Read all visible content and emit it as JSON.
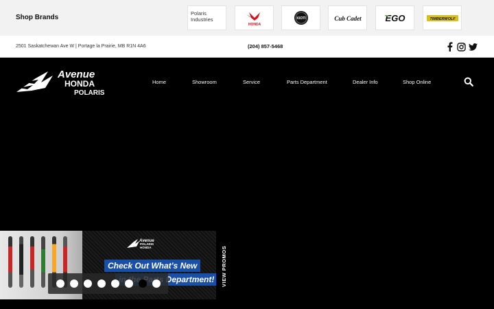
{
  "brands": {
    "title": "Shop Brands",
    "items": [
      {
        "name": "polaris",
        "label": "Polaris Industries"
      },
      {
        "name": "honda",
        "label": "HONDA"
      },
      {
        "name": "kioti",
        "label": "KIOTI"
      },
      {
        "name": "cubcadet",
        "label": "Cub Cadet"
      },
      {
        "name": "ego",
        "label": "EGO"
      },
      {
        "name": "timberwolf",
        "label": "TIMBERWOLF"
      }
    ]
  },
  "info": {
    "address": "2501 Saskatchewan Ave W | Portage la Prairie, MB R1N 4A6",
    "phone": "(204) 857-5468"
  },
  "logo": {
    "line1": "Avenue",
    "line2": "HONDA",
    "line3": "POLARIS"
  },
  "nav": {
    "items": [
      "Home",
      "Showroom",
      "Service",
      "Parts Department",
      "Dealer Info",
      "Shop Online"
    ]
  },
  "promo": {
    "logo_line1": "Avenue",
    "logo_line2": "POLARIS",
    "logo_line3": "HONDA",
    "line1": "Check Out What's New",
    "line2": "in the Parts Department!",
    "slide_count": 8,
    "active_slide": 6,
    "view_label": "VIEW PROMOS"
  },
  "colors": {
    "honda_red": "#d3141b",
    "ego_green": "#6cb33e",
    "timberwolf_yellow": "#d7c01e",
    "promo_blue": "#1a4fa8"
  }
}
